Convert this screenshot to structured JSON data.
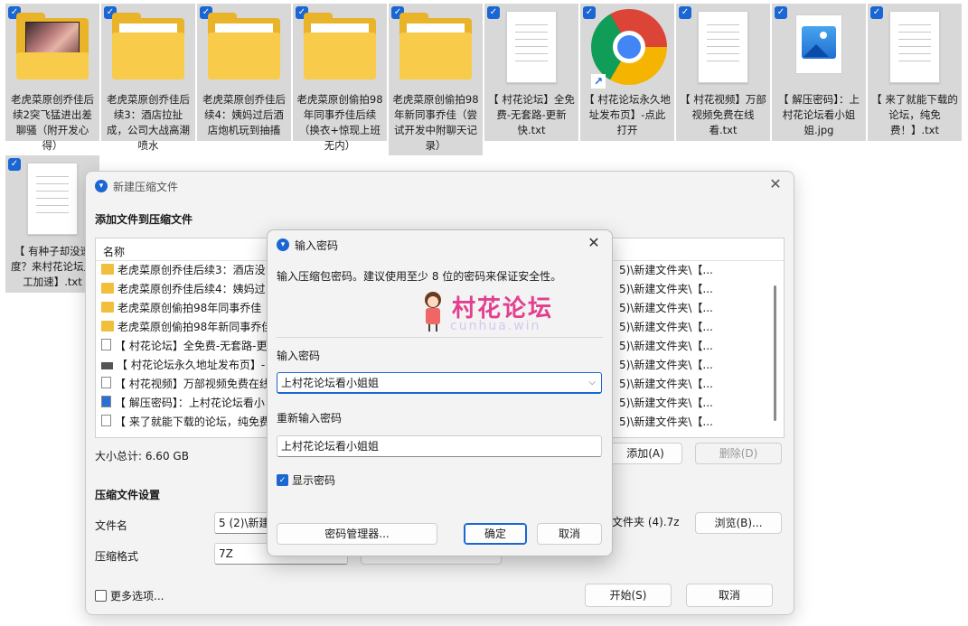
{
  "desktop": {
    "files": [
      {
        "label": "老虎菜原创乔佳后续2突飞猛进出差聊骚（附开发心得）",
        "icon": "video-folder-icon"
      },
      {
        "label": "老虎菜原创乔佳后续3：酒店拉扯成，公司大战高潮喷水",
        "icon": "folder-icon"
      },
      {
        "label": "老虎菜原创乔佳后续4：姨妈过后酒店炮机玩到抽搐",
        "icon": "folder-icon"
      },
      {
        "label": "老虎菜原创偷拍98年同事乔佳后续（换衣+惊现上班无内）",
        "icon": "folder-icon"
      },
      {
        "label": "老虎菜原创偷拍98年新同事乔佳（尝试开发中附聊天记录）",
        "icon": "folder-icon"
      },
      {
        "label": "【 村花论坛】全免费-无套路-更新快.txt",
        "icon": "text-file-icon"
      },
      {
        "label": "【 村花论坛永久地址发布页】-点此打开",
        "icon": "chrome-shortcut-icon"
      },
      {
        "label": "【 村花视频】万部视频免费在线看.txt",
        "icon": "text-file-icon"
      },
      {
        "label": "【 解压密码】：上村花论坛看小姐姐.jpg",
        "icon": "image-file-icon"
      },
      {
        "label": "【 来了就能下载的论坛，纯免费！】.txt",
        "icon": "text-file-icon"
      },
      {
        "label": "【 有种子却没速度？来村花论坛人工加速】.txt",
        "icon": "text-file-icon"
      }
    ]
  },
  "archive_dialog": {
    "title": "新建压缩文件",
    "add_files_heading": "添加文件到压缩文件",
    "list_header_name": "名称",
    "rows": [
      {
        "name": "老虎菜原创乔佳后续3：酒店没",
        "path": "5)\\新建文件夹\\【...",
        "icon": "folder"
      },
      {
        "name": "老虎菜原创乔佳后续4：姨妈过",
        "path": "5)\\新建文件夹\\【...",
        "icon": "folder"
      },
      {
        "name": "老虎菜原创偷拍98年同事乔佳",
        "path": "5)\\新建文件夹\\【...",
        "icon": "folder"
      },
      {
        "name": "老虎菜原创偷拍98年新同事乔佳",
        "path": "5)\\新建文件夹\\【...",
        "icon": "folder"
      },
      {
        "name": "【 村花论坛】全免费-无套路-更",
        "path": "5)\\新建文件夹\\【...",
        "icon": "doc"
      },
      {
        "name": "【 村花论坛永久地址发布页】-",
        "path": "5)\\新建文件夹\\【...",
        "icon": "link"
      },
      {
        "name": "【 村花视频】万部视频免费在线",
        "path": "5)\\新建文件夹\\【...",
        "icon": "doc"
      },
      {
        "name": "【 解压密码】：上村花论坛看小",
        "path": "5)\\新建文件夹\\【...",
        "icon": "img"
      },
      {
        "name": "【 来了就能下载的论坛，纯免费",
        "path": "5)\\新建文件夹\\【...",
        "icon": "doc"
      }
    ],
    "total_size": "大小总计: 6.60 GB",
    "add_button": "添加(A)",
    "delete_button": "删除(D)",
    "settings_heading": "压缩文件设置",
    "filename_label": "文件名",
    "filename_value_left": "5 (2)\\新建",
    "filename_value_right": "文件夹 (4).7z",
    "browse_button": "浏览(B)...",
    "format_label": "压缩格式",
    "format_value": "7Z",
    "more_options_label": "更多选项...",
    "start_button": "开始(S)",
    "cancel_button": "取消"
  },
  "password_dialog": {
    "title": "输入密码",
    "description": "输入压缩包密码。建议使用至少 8 位的密码来保证安全性。",
    "watermark_title": "村花论坛",
    "watermark_sub": "cunhua.win",
    "password_label": "输入密码",
    "password_value": "上村花论坛看小姐姐",
    "reenter_label": "重新输入密码",
    "reenter_value": "上村花论坛看小姐姐",
    "show_password_label": "显示密码",
    "show_password_checked": true,
    "manager_button": "密码管理器...",
    "ok_button": "确定",
    "cancel_button": "取消"
  }
}
